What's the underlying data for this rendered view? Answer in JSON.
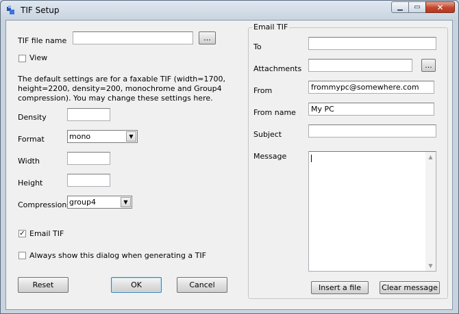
{
  "window": {
    "title": "TIF Setup",
    "minimize_glyph": "▁",
    "maximize_glyph": "▭",
    "close_glyph": "✕"
  },
  "left": {
    "tif_file_name_label": "TIF file name",
    "tif_file_name_value": "",
    "browse_label": "...",
    "view_label": "View",
    "view_checked": false,
    "description": "The default settings are for a faxable TIF (width=1700, height=2200, density=200, monochrome and Group4 compression). You may change these settings here.",
    "density_label": "Density",
    "density_value": "",
    "format_label": "Format",
    "format_value": "mono",
    "width_label": "Width",
    "width_value": "",
    "height_label": "Height",
    "height_value": "",
    "compression_label": "Compression",
    "compression_value": "group4",
    "email_tif_label": "Email TIF",
    "email_tif_checked": true,
    "always_show_label": "Always show this dialog when generating a TIF",
    "always_show_checked": false,
    "reset_label": "Reset",
    "ok_label": "OK",
    "cancel_label": "Cancel"
  },
  "email": {
    "group_title": "Email TIF",
    "to_label": "To",
    "to_value": "",
    "attachments_label": "Attachments",
    "attachments_value": "",
    "attach_browse_label": "...",
    "from_label": "From",
    "from_value": "frommypc@somewhere.com",
    "from_name_label": "From name",
    "from_name_value": "My PC",
    "subject_label": "Subject",
    "subject_value": "",
    "message_label": "Message",
    "message_value": "",
    "insert_file_label": "Insert a file",
    "clear_message_label": "Clear message"
  },
  "icons": {
    "check_glyph": "✓",
    "dropdown_glyph": "▼",
    "scroll_up_glyph": "▲",
    "scroll_down_glyph": "▼"
  },
  "colors": {
    "title_bar": "#c7d3df",
    "close_button": "#c2462e",
    "dialog_background": "#f0f0f0",
    "default_button_border": "#3c7fb1"
  }
}
